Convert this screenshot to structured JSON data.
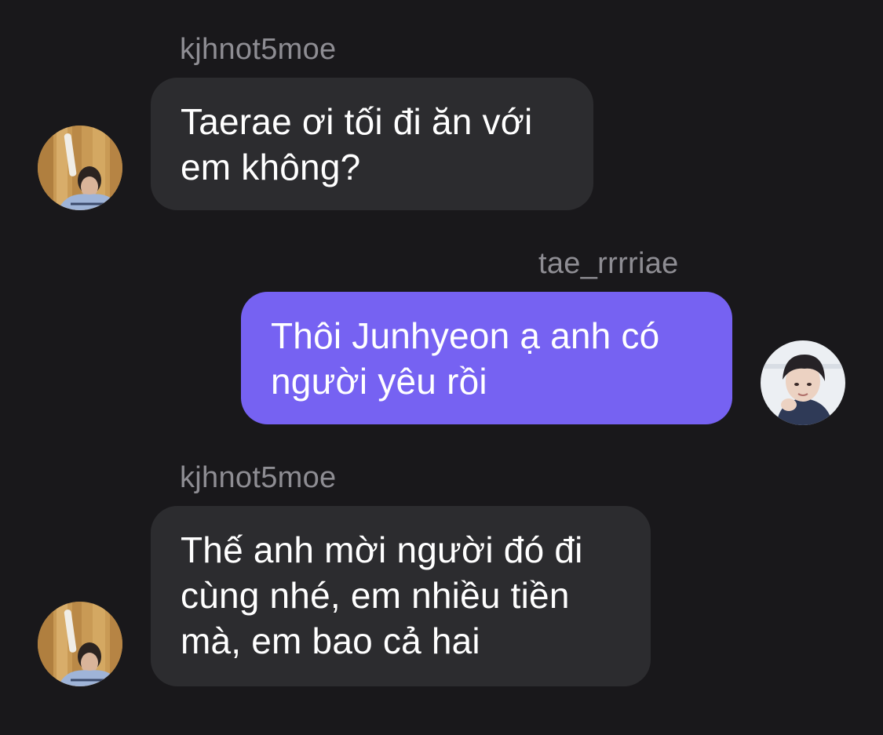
{
  "messages": [
    {
      "sender": "kjhnot5moe",
      "direction": "incoming",
      "lines": [
        "Taerae ơi tối đi ăn với",
        "em không?"
      ],
      "avatar": "kjhnot5moe-avatar"
    },
    {
      "sender": "tae_rrrriae",
      "direction": "outgoing",
      "lines": [
        "Thôi Junhyeon ạ anh có",
        "người yêu rồi"
      ],
      "avatar": "tae_rrrriae-avatar"
    },
    {
      "sender": "kjhnot5moe",
      "direction": "incoming",
      "lines": [
        "Thế anh mời người đó đi",
        "cùng nhé, em nhiều tiền",
        "mà, em bao cả hai"
      ],
      "avatar": "kjhnot5moe-avatar"
    }
  ],
  "colors": {
    "background": "#19181b",
    "incoming_bubble": "#2c2c2f",
    "outgoing_bubble": "#7662f2",
    "username": "#8e8d93",
    "message_text": "#ffffff"
  }
}
